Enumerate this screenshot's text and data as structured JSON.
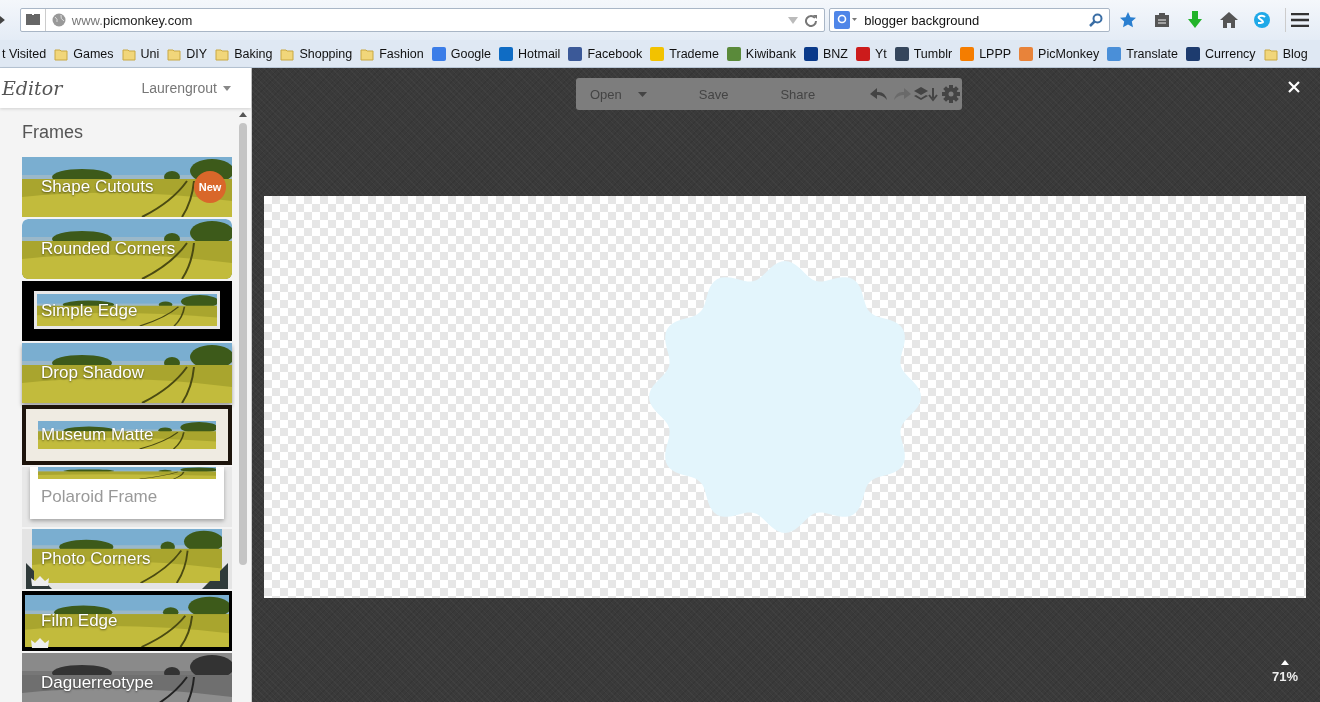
{
  "browser": {
    "url_prefix": "www.",
    "url_domain": "picmonkey.com",
    "search": {
      "value": "blogger background"
    },
    "bookmarks": [
      {
        "label": "t Visited",
        "kind": "plain"
      },
      {
        "label": "Games",
        "kind": "folder"
      },
      {
        "label": "Uni",
        "kind": "folder"
      },
      {
        "label": "DIY",
        "kind": "folder"
      },
      {
        "label": "Baking",
        "kind": "folder"
      },
      {
        "label": "Shopping",
        "kind": "folder"
      },
      {
        "label": "Fashion",
        "kind": "folder"
      },
      {
        "label": "Google",
        "kind": "site",
        "color": "#3b7de8"
      },
      {
        "label": "Hotmail",
        "kind": "site",
        "color": "#0f6cc4"
      },
      {
        "label": "Facebook",
        "kind": "site",
        "color": "#3b5998"
      },
      {
        "label": "Trademe",
        "kind": "site",
        "color": "#f2c200"
      },
      {
        "label": "Kiwibank",
        "kind": "site",
        "color": "#5a8a3a"
      },
      {
        "label": "BNZ",
        "kind": "site",
        "color": "#0a3a8a"
      },
      {
        "label": "Yt",
        "kind": "site",
        "color": "#cc1b1b"
      },
      {
        "label": "Tumblr",
        "kind": "site",
        "color": "#35465c"
      },
      {
        "label": "LPPP",
        "kind": "site",
        "color": "#f57d00"
      },
      {
        "label": "PicMonkey",
        "kind": "site",
        "color": "#e8833a"
      },
      {
        "label": "Translate",
        "kind": "site",
        "color": "#4a8fd8"
      },
      {
        "label": "Currency",
        "kind": "site",
        "color": "#1d3b6e"
      },
      {
        "label": "Blog",
        "kind": "folder"
      }
    ]
  },
  "editor": {
    "logo": "Editor",
    "user": "Laurengrout",
    "section": "Frames",
    "frames": [
      {
        "label": "Shape Cutouts",
        "kind": "cutout",
        "badge": "New",
        "premium": false
      },
      {
        "label": "Rounded Corners",
        "kind": "rounded",
        "premium": false
      },
      {
        "label": "Simple Edge",
        "kind": "simple",
        "premium": false
      },
      {
        "label": "Drop Shadow",
        "kind": "shadow",
        "premium": false
      },
      {
        "label": "Museum Matte",
        "kind": "matte",
        "premium": false
      },
      {
        "label": "Polaroid Frame",
        "kind": "polaroid",
        "premium": false
      },
      {
        "label": "Photo Corners",
        "kind": "corners",
        "premium": true
      },
      {
        "label": "Film Edge",
        "kind": "film",
        "premium": true
      },
      {
        "label": "Daguerreotype",
        "kind": "daguerreotype",
        "premium": false
      }
    ]
  },
  "toolbar": [
    {
      "label": "Open",
      "kind": "menu",
      "disabled": false
    },
    {
      "label": "Save",
      "kind": "text",
      "disabled": false
    },
    {
      "label": "Share",
      "kind": "text",
      "disabled": false
    },
    {
      "kind": "undo",
      "disabled": false
    },
    {
      "kind": "redo",
      "disabled": true
    },
    {
      "kind": "layers",
      "disabled": false
    },
    {
      "kind": "settings",
      "disabled": false
    }
  ],
  "zoom": "71%"
}
